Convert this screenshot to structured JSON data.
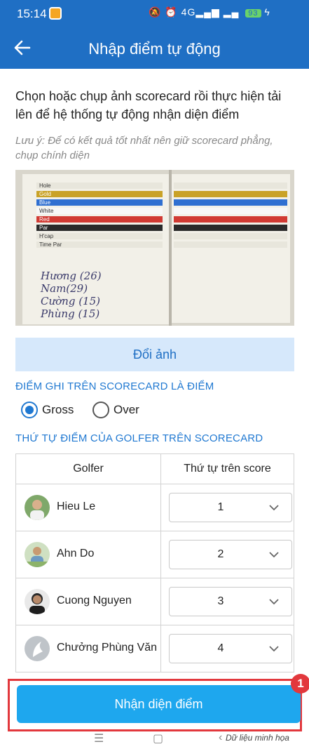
{
  "status_bar": {
    "time": "15:14",
    "network": "4G",
    "battery": "93"
  },
  "app_bar": {
    "title": "Nhập điểm tự động"
  },
  "instruction": "Chọn hoặc chụp ảnh scorecard rồi thực hiện tải lên để hệ thống tự động nhận diện điểm",
  "note": "Lưu ý: Để có kết quả tốt nhất nên giữ scorecard phẳng, chụp chính diện",
  "scorecard": {
    "row_labels": [
      "Hole",
      "Gold",
      "Blue",
      "White",
      "Red",
      "Par",
      "H'cap",
      "Time Par"
    ],
    "row_colors": [
      "#e8e6dc",
      "#c9a227",
      "#2f6fd1",
      "#f7f7f7",
      "#d13a33",
      "#2a2a2a",
      "#e8e6dc",
      "#e8e6dc"
    ],
    "handwriting": [
      "Hương (26)",
      "Nam(29)",
      "Cường (15)",
      "Phùng (15)"
    ]
  },
  "change_image_button": "Đổi ảnh",
  "score_type": {
    "title": "ĐIỂM GHI TRÊN SCORECARD LÀ ĐIỂM",
    "options": [
      {
        "label": "Gross",
        "checked": true
      },
      {
        "label": "Over",
        "checked": false
      }
    ]
  },
  "golfer_order": {
    "title": "THỨ TỰ ĐIỂM CỦA GOLFER TRÊN SCORECARD",
    "headers": {
      "golfer": "Golfer",
      "order": "Thứ tự trên score"
    },
    "rows": [
      {
        "name": "Hieu Le",
        "order": "1"
      },
      {
        "name": "Ahn Do",
        "order": "2"
      },
      {
        "name": "Cuong Nguyen",
        "order": "3"
      },
      {
        "name": "Chưởng Phùng Văn",
        "order": "4"
      }
    ]
  },
  "recognize_button": "Nhận diện điểm",
  "step_badge": "1",
  "watermark": "Dữ liệu minh họa"
}
